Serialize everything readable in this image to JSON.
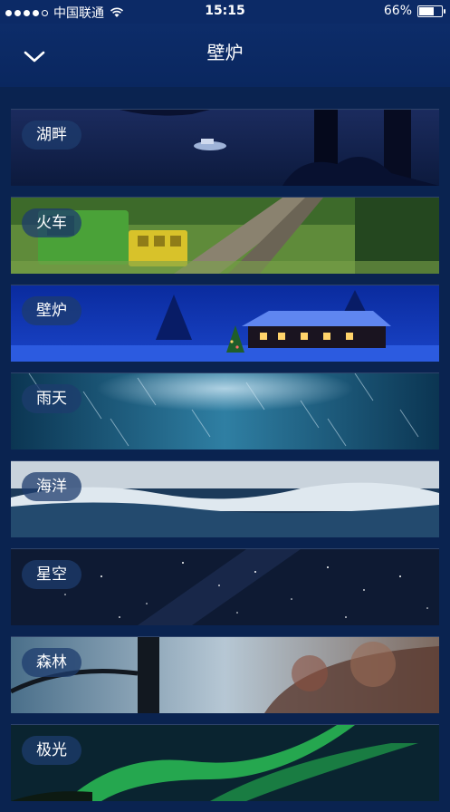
{
  "status": {
    "carrier": "中国联通",
    "time": "15:15",
    "battery_text": "66%",
    "battery_level": 0.66
  },
  "header": {
    "title": "壁炉"
  },
  "scenes": [
    {
      "label": "湖畔"
    },
    {
      "label": "火车"
    },
    {
      "label": "壁炉"
    },
    {
      "label": "雨天"
    },
    {
      "label": "海洋"
    },
    {
      "label": "星空"
    },
    {
      "label": "森林"
    },
    {
      "label": "极光"
    }
  ],
  "colors": {
    "status_bar": "#0c2a66",
    "nav_bar": "#0d2c69",
    "background": "#0a2350"
  }
}
